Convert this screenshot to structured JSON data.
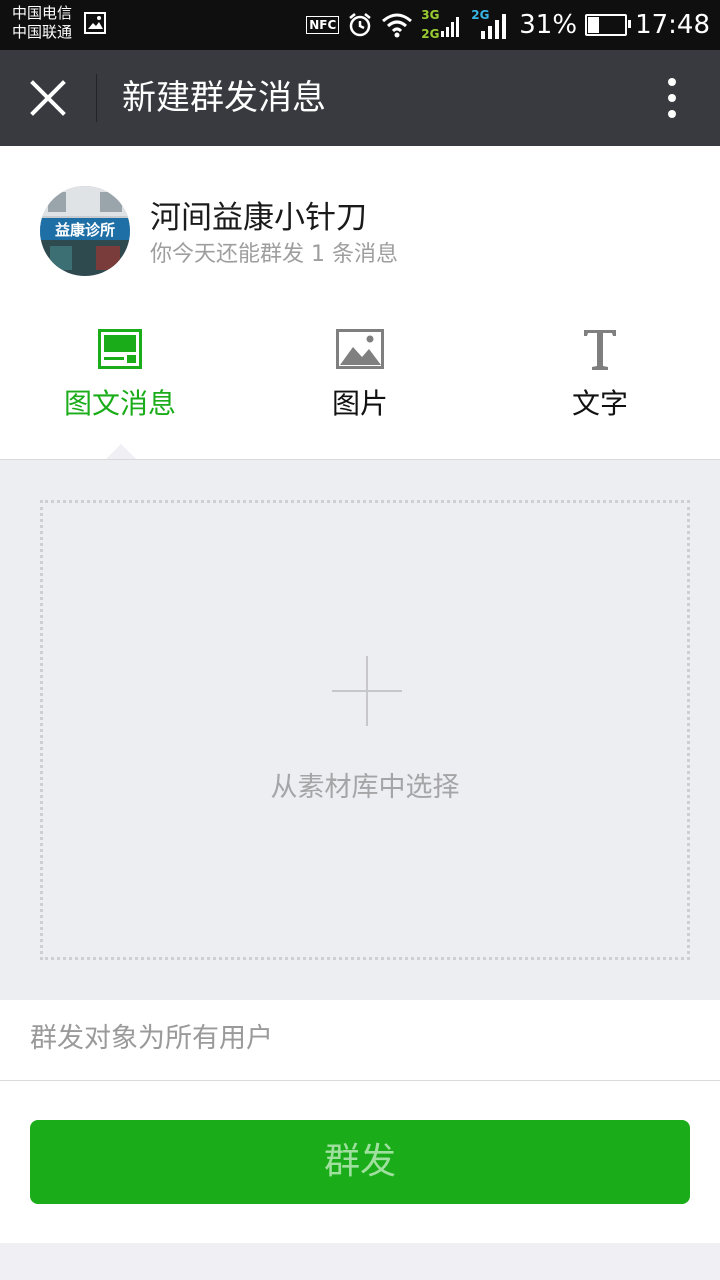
{
  "status_bar": {
    "carrier_1": "中国电信",
    "carrier_2": "中国联通",
    "nfc": "NFC",
    "net_1_top": "3G",
    "net_1_bottom": "2G",
    "net_2": "2G",
    "battery_pct": "31%",
    "battery_level": 0.31,
    "time": "17:48"
  },
  "titlebar": {
    "title": "新建群发消息"
  },
  "account": {
    "name": "河间益康小针刀",
    "quota_text": "你今天还能群发 1 条消息",
    "avatar_sign": "益康诊所"
  },
  "tabs": [
    {
      "label": "图文消息",
      "icon": "rich-media-icon",
      "active": true
    },
    {
      "label": "图片",
      "icon": "image-icon",
      "active": false
    },
    {
      "label": "文字",
      "icon": "text-icon",
      "active": false
    }
  ],
  "content": {
    "picker_label": "从素材库中选择"
  },
  "recipients": {
    "text": "群发对象为所有用户"
  },
  "footer": {
    "send_label": "群发"
  },
  "colors": {
    "accent": "#1aad19",
    "titlebar": "#393a3f",
    "statusbar": "#0f0f10"
  }
}
